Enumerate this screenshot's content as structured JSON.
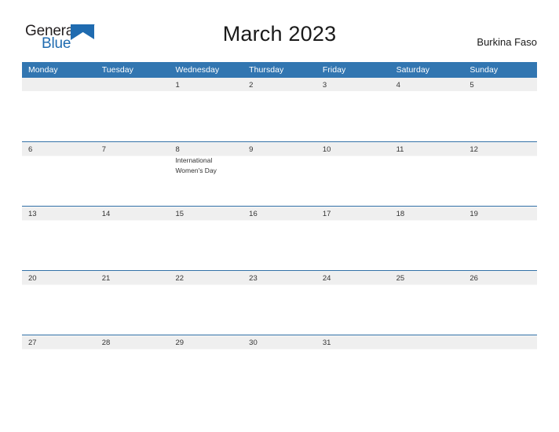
{
  "brand": {
    "name_part1": "General",
    "name_part2": "Blue",
    "mark": "triangle-logo-icon",
    "color_dark": "#231f20",
    "color_blue": "#1f6bb0"
  },
  "header": {
    "title": "March 2023",
    "country": "Burkina Faso"
  },
  "theme": {
    "header_bar": "#3276b1",
    "row_border": "#2e6da4",
    "date_band": "#efefef",
    "cell_bg": "#ffffff",
    "text": "#333333"
  },
  "calendar": {
    "weekdays": [
      "Monday",
      "Tuesday",
      "Wednesday",
      "Thursday",
      "Friday",
      "Saturday",
      "Sunday"
    ],
    "weeks": [
      [
        {
          "day": "",
          "event": ""
        },
        {
          "day": "",
          "event": ""
        },
        {
          "day": "1",
          "event": ""
        },
        {
          "day": "2",
          "event": ""
        },
        {
          "day": "3",
          "event": ""
        },
        {
          "day": "4",
          "event": ""
        },
        {
          "day": "5",
          "event": ""
        }
      ],
      [
        {
          "day": "6",
          "event": ""
        },
        {
          "day": "7",
          "event": ""
        },
        {
          "day": "8",
          "event": "International Women's Day"
        },
        {
          "day": "9",
          "event": ""
        },
        {
          "day": "10",
          "event": ""
        },
        {
          "day": "11",
          "event": ""
        },
        {
          "day": "12",
          "event": ""
        }
      ],
      [
        {
          "day": "13",
          "event": ""
        },
        {
          "day": "14",
          "event": ""
        },
        {
          "day": "15",
          "event": ""
        },
        {
          "day": "16",
          "event": ""
        },
        {
          "day": "17",
          "event": ""
        },
        {
          "day": "18",
          "event": ""
        },
        {
          "day": "19",
          "event": ""
        }
      ],
      [
        {
          "day": "20",
          "event": ""
        },
        {
          "day": "21",
          "event": ""
        },
        {
          "day": "22",
          "event": ""
        },
        {
          "day": "23",
          "event": ""
        },
        {
          "day": "24",
          "event": ""
        },
        {
          "day": "25",
          "event": ""
        },
        {
          "day": "26",
          "event": ""
        }
      ],
      [
        {
          "day": "27",
          "event": ""
        },
        {
          "day": "28",
          "event": ""
        },
        {
          "day": "29",
          "event": ""
        },
        {
          "day": "30",
          "event": ""
        },
        {
          "day": "31",
          "event": ""
        },
        {
          "day": "",
          "event": ""
        },
        {
          "day": "",
          "event": ""
        }
      ]
    ]
  }
}
